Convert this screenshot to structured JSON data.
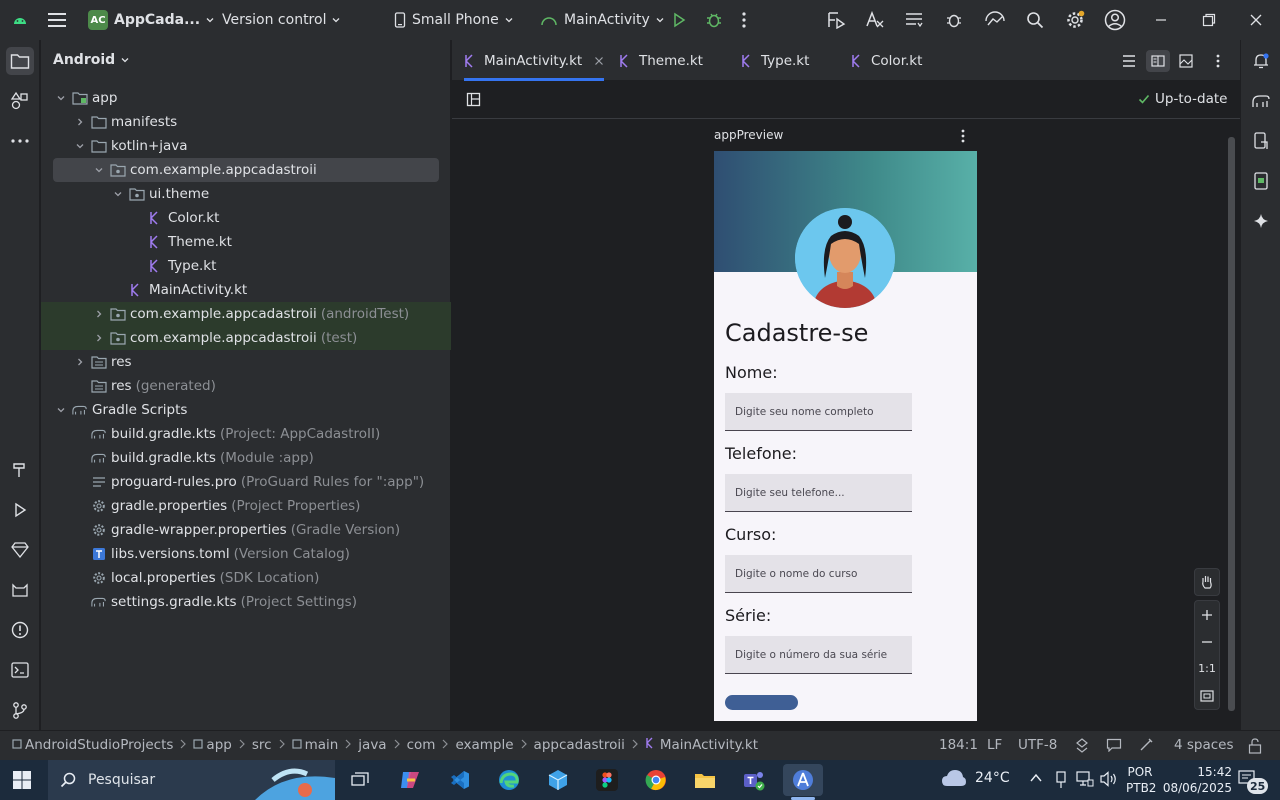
{
  "titlebar": {
    "app_badge": "AC",
    "project_name": "AppCada...",
    "vcs": "Version control",
    "device": "Small Phone",
    "run_config": "MainActivity"
  },
  "project_panel": {
    "view_mode": "Android",
    "tree": [
      {
        "label": "app",
        "hint": ""
      },
      {
        "label": "manifests",
        "hint": ""
      },
      {
        "label": "kotlin+java",
        "hint": ""
      },
      {
        "label": "com.example.appcadastroii",
        "hint": ""
      },
      {
        "label": "ui.theme",
        "hint": ""
      },
      {
        "label": "Color.kt",
        "hint": ""
      },
      {
        "label": "Theme.kt",
        "hint": ""
      },
      {
        "label": "Type.kt",
        "hint": ""
      },
      {
        "label": "MainActivity.kt",
        "hint": ""
      },
      {
        "label": "com.example.appcadastroii",
        "hint": "(androidTest)"
      },
      {
        "label": "com.example.appcadastroii",
        "hint": "(test)"
      },
      {
        "label": "res",
        "hint": ""
      },
      {
        "label": "res",
        "hint": "(generated)"
      },
      {
        "label": "Gradle Scripts",
        "hint": ""
      },
      {
        "label": "build.gradle.kts",
        "hint": "(Project: AppCadastroII)"
      },
      {
        "label": "build.gradle.kts",
        "hint": "(Module :app)"
      },
      {
        "label": "proguard-rules.pro",
        "hint": "(ProGuard Rules for \":app\")"
      },
      {
        "label": "gradle.properties",
        "hint": "(Project Properties)"
      },
      {
        "label": "gradle-wrapper.properties",
        "hint": "(Gradle Version)"
      },
      {
        "label": "libs.versions.toml",
        "hint": "(Version Catalog)"
      },
      {
        "label": "local.properties",
        "hint": "(SDK Location)"
      },
      {
        "label": "settings.gradle.kts",
        "hint": "(Project Settings)"
      }
    ]
  },
  "editor": {
    "tabs": [
      {
        "label": "MainActivity.kt"
      },
      {
        "label": "Theme.kt"
      },
      {
        "label": "Type.kt"
      },
      {
        "label": "Color.kt"
      }
    ],
    "status": "Up-to-date",
    "preview_name": "appPreview",
    "zoom_reset": "1:1"
  },
  "app_preview": {
    "title": "Cadastre-se",
    "fields": [
      {
        "label": "Nome:",
        "placeholder": "Digite seu nome completo"
      },
      {
        "label": "Telefone:",
        "placeholder": "Digite seu telefone..."
      },
      {
        "label": "Curso:",
        "placeholder": "Digite o nome do curso"
      },
      {
        "label": "Série:",
        "placeholder": "Digite o número da sua série"
      }
    ],
    "colors": {
      "header_start": "#2f4e72",
      "header_end": "#58b0a8",
      "button": "#3f5f95"
    }
  },
  "statusbar": {
    "breadcrumb": [
      "AndroidStudioProjects",
      "app",
      "src",
      "main",
      "java",
      "com",
      "example",
      "appcadastroii",
      "MainActivity.kt"
    ],
    "position": "184:1",
    "line_sep": "LF",
    "encoding": "UTF-8",
    "indent": "4 spaces"
  },
  "taskbar": {
    "search_placeholder": "Pesquisar",
    "weather": "24°C",
    "lang_line1": "POR",
    "lang_line2": "PTB2",
    "time": "15:42",
    "date": "08/06/2025",
    "notif_count": "25"
  }
}
